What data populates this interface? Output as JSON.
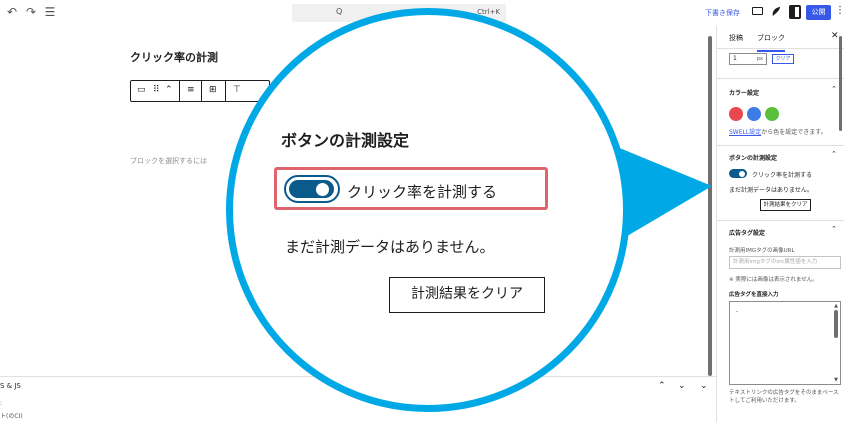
{
  "toolbar": {
    "undo": "↶",
    "redo": "↷",
    "list": "☰",
    "command_placeholder": "Q",
    "command_shortcut": "Ctrl+K",
    "save_draft": "下書き保存",
    "publish": "公開",
    "more": "⋮"
  },
  "editor": {
    "title": "クリック率の計測",
    "block_hint": "ブロックを選択するには",
    "block_toolbar": [
      "▭",
      "⠿",
      "⌃",
      "≡",
      "⊞",
      "⊤"
    ]
  },
  "meta_panel": {
    "label": "S & JS",
    "up": "⌃",
    "down": "⌄",
    "collapse": "⌄",
    "sub1": ":",
    "sub2": "ト(のCI)"
  },
  "sidebar": {
    "tabs": [
      "投稿",
      "ブロック"
    ],
    "active_tab": "ブロック",
    "close": "✕",
    "number_value": "1",
    "number_unit": "px",
    "clear_mini": "クリア",
    "color_section": {
      "title": "カラー設定",
      "swatches": [
        "#e8474e",
        "#3c7ce6",
        "#5ac03c"
      ],
      "link_text": "SWELL設定",
      "link_suffix": "から色を設定できます。"
    },
    "measure_section": {
      "title": "ボタンの計測設定",
      "toggle_label": "クリック率を計測する",
      "no_data": "まだ計測データはありません。",
      "clear_button": "計測結果をクリア"
    },
    "ad_section": {
      "title": "広告タグ設定",
      "imp_label": "計測用IMGタグの画像URL",
      "imp_placeholder": "計測用imgタグのsrc属性値を入力",
      "imp_note": "※ 実際には画像は表示されません。",
      "direct_label": "広告タグを直接入力",
      "textarea_value": "-",
      "note": "テキストリンクの広告タグをそのままペーストしてご利用いただけます。"
    }
  },
  "magnifier": {
    "title": "ボタンの計測設定",
    "toggle_label": "クリック率を計測する",
    "no_data": "まだ計測データはありません。",
    "clear_button": "計測結果をクリア",
    "border_color": "#00a9e6",
    "highlight_color": "#e0646e"
  },
  "colors": {
    "accent": "#3858e9",
    "toggle": "#0b5a8c"
  }
}
